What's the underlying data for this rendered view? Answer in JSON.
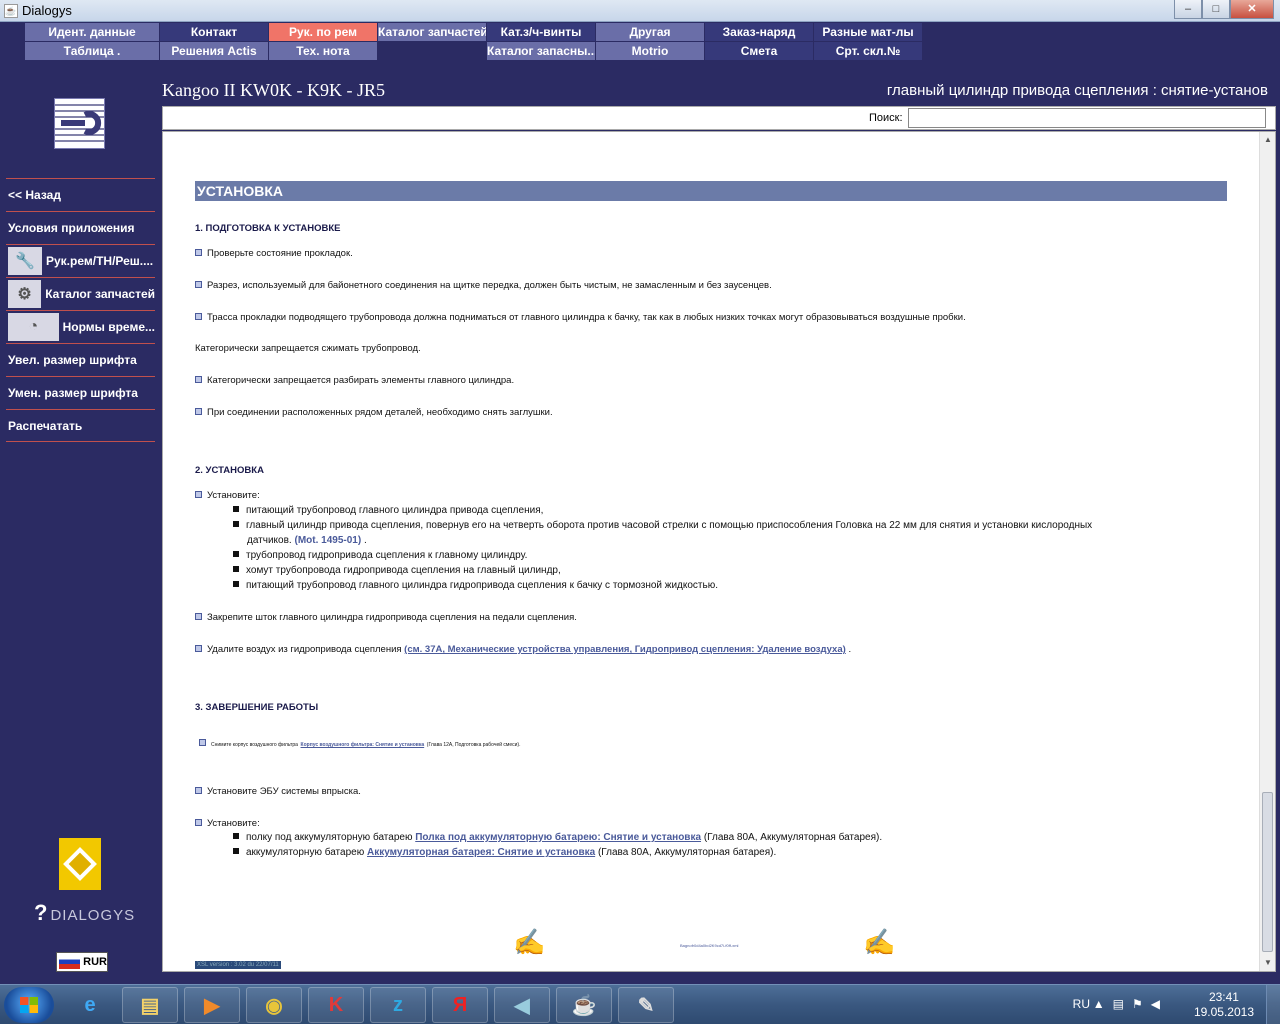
{
  "window": {
    "title": "Dialogys",
    "controls": {
      "minimize": "–",
      "maximize": "□",
      "close": "✕"
    }
  },
  "top_menu": {
    "row1": [
      "Идент. данные",
      "Контакт",
      "Рук. по рем",
      "Каталог запчастей",
      "Кат.з/ч-винты",
      "Другая",
      "Заказ-наряд",
      "Разные мат-лы"
    ],
    "row2": [
      "Таблица .",
      "Решения Actis",
      "Тех. нота",
      "",
      "Каталог запасны...",
      "Motrio",
      "Смета",
      "Срт. скл.№"
    ],
    "active": "Рук. по рем"
  },
  "sidebar": {
    "items": [
      {
        "label": "<< Назад",
        "icon": ""
      },
      {
        "label": "Условия приложения",
        "icon": ""
      },
      {
        "label": "Рук.рем/ТН/Реш....",
        "icon": "wrench-icon"
      },
      {
        "label": "Каталог запчастей",
        "icon": "part-icon"
      },
      {
        "label": "Нормы време...",
        "icon": "gauge-icon"
      },
      {
        "label": "Увел. размер шрифта",
        "icon": ""
      },
      {
        "label": "Умен. размер шрифта",
        "icon": ""
      },
      {
        "label": "Распечатать",
        "icon": ""
      }
    ],
    "brand": "DIALOGYS",
    "currency": "RUR"
  },
  "header": {
    "vehicle": "Kangoo II KW0K - K9K - JR5",
    "doc_title": "главный цилиндр привода сцепления : снятие-установ"
  },
  "search": {
    "label": "Поиск:",
    "value": "",
    "placeholder": ""
  },
  "content": {
    "section_title": "УСТАНОВКА",
    "h1": "1. ПОДГОТОВКА К УСТАНОВКЕ",
    "p1": "Проверьте состояние прокладок.",
    "p2": "Разрез, используемый для байонетного соединения на щитке передка, должен быть чистым, не замасленным и без заусенцев.",
    "p3": "Трасса прокладки подводящего трубопровода должна подниматься от главного цилиндра к бачку, так как в любых низких точках могут образовываться воздушные пробки.",
    "p4": "Категорически запрещается сжимать трубопровод.",
    "p5": "Категорически запрещается разбирать элементы главного цилиндра.",
    "p6": "При соединении расположенных рядом деталей, необходимо снять заглушки.",
    "h2": "2. УСТАНОВКА",
    "p7": "Установите:",
    "s1": "питающий трубопровод главного цилиндра привода сцепления,",
    "s2a": "главный цилиндр привода сцепления, повернув его на четверть оборота против часовой стрелки с помощью приспособления Головка на 22 мм для снятия и установки кислородных",
    "s2b": "датчиков.",
    "s2_ref": "(Mot. 1495-01)",
    "s2_end": ".",
    "s3": "трубопровод гидропривода сцепления к главному цилиндру.",
    "s4": "хомут трубопровода гидропривода сцепления на главный цилиндр,",
    "s5": "питающий трубопровод главного цилиндра гидропривода сцепления к бачку с тормозной жидкостью.",
    "p8": "Закрепите шток главного цилиндра гидропривода сцепления на педали сцепления.",
    "p9": "Удалите воздух из гидропривода сцепления",
    "p9_link": "(см. 37A, Механические устройства управления, Гидропривод сцепления: Удаление воздуха)",
    "p9_end": ".",
    "h3": "3. ЗАВЕРШЕНИЕ РАБОТЫ",
    "p10": "Снимите корпус воздушного фильтра",
    "p10_link": "Корпус воздушного фильтра: Снятие и установка",
    "p10_end": "(Глава 12A, Подготовка рабочей смеси).",
    "p11": "Установите ЭБУ системы впрыска.",
    "p12": "Установите:",
    "t1": "полку под аккумуляторную батарею",
    "t1_link": "Полка под аккумуляторную батарею: Снятие и установка",
    "t1_end": "(Глава 80A, Аккумуляторная батарея).",
    "t2": "аккумуляторную батарею",
    "t2_link": "Аккумуляторная батарея: Снятие и установка",
    "t2_end": "(Глава 80A, Аккумуляторная батарея).",
    "footer_small_link": "Bagnofr0d4a0bd2K9cd7i-f0ff-xml",
    "version": "XSL version : 3.02 du 22/07/11"
  },
  "taskbar": {
    "apps": [
      {
        "name": "ie-icon",
        "glyph": "e"
      },
      {
        "name": "explorer-icon",
        "glyph": "▤"
      },
      {
        "name": "media-player-icon",
        "glyph": "▶"
      },
      {
        "name": "chrome-icon",
        "glyph": "◉"
      },
      {
        "name": "kaspersky-icon",
        "glyph": "K"
      },
      {
        "name": "z-app-icon",
        "glyph": "z"
      },
      {
        "name": "yandex-icon",
        "glyph": "Я"
      },
      {
        "name": "volume-app-icon",
        "glyph": "◀"
      },
      {
        "name": "java-icon",
        "glyph": "☕"
      },
      {
        "name": "paint-icon",
        "glyph": "✎"
      }
    ],
    "lang": "RU",
    "time": "23:41",
    "date": "19.05.2013"
  },
  "colors": {
    "background": "#2b2b63",
    "menu_light": "#6a6ea8",
    "menu_dark": "#36397a",
    "menu_active": "#f07468",
    "section_bar": "#6b7ba8",
    "divider": "#c0504d",
    "link": "#4a5a9a"
  }
}
